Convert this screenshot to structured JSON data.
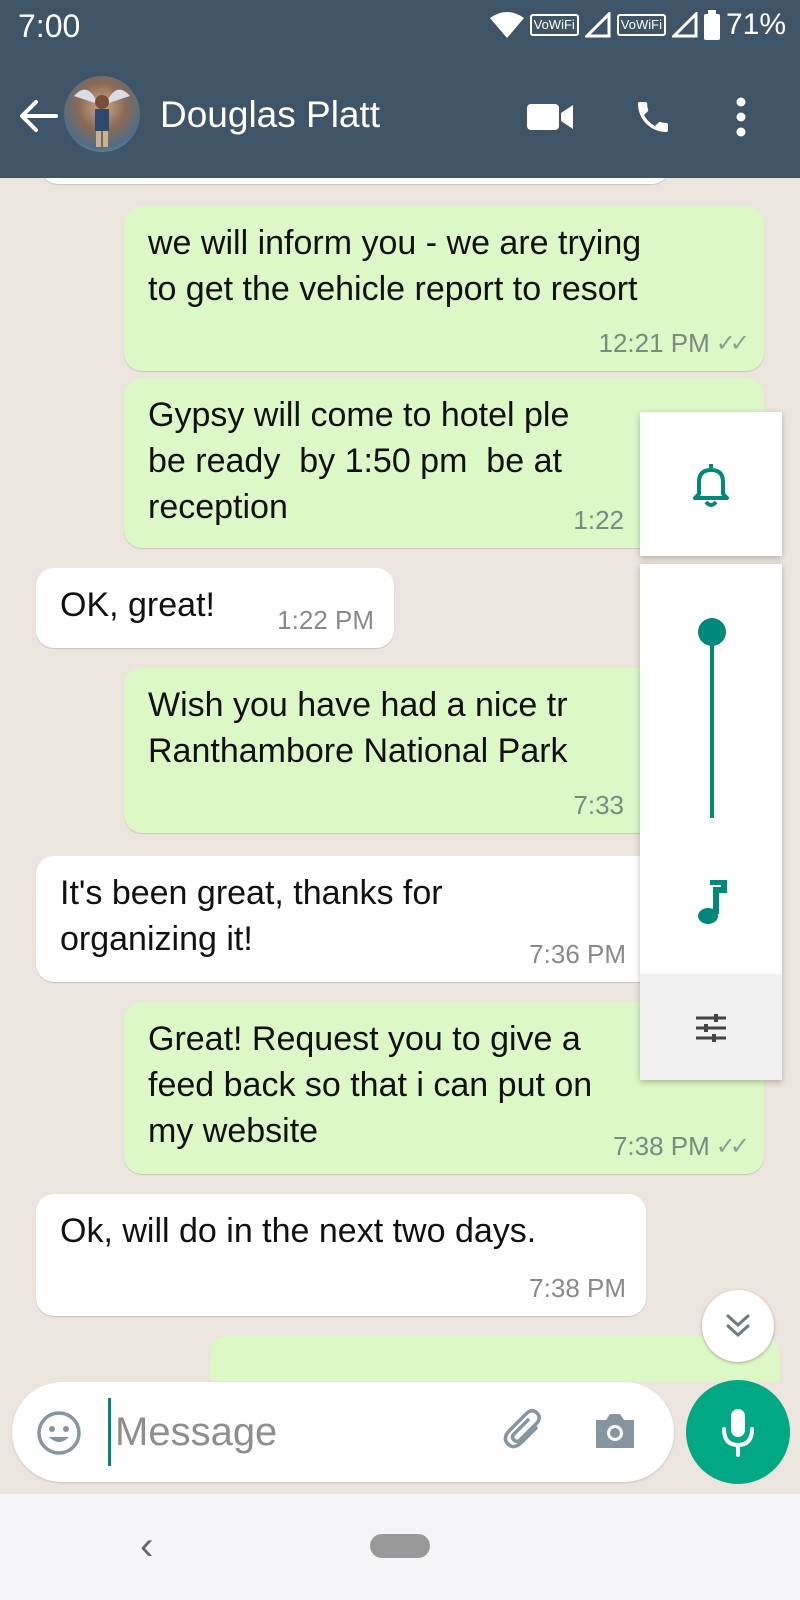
{
  "status_bar": {
    "time": "7:00",
    "vowifi_1": "VoWiFi",
    "vowifi_2": "VoWiFi",
    "battery": "71%"
  },
  "header": {
    "contact_name": "Douglas Platt",
    "icons": [
      "back-arrow-icon",
      "video-call-icon",
      "phone-call-icon",
      "more-options-icon"
    ]
  },
  "messages": [
    {
      "direction": "outgoing",
      "text": "we will inform you - we are trying\nto get the vehicle report to resort",
      "time": "12:21 PM",
      "read": true
    },
    {
      "direction": "outgoing",
      "text": "Gypsy will come to hotel ple\nbe ready  by 1:50 pm  be at\nreception",
      "time": "1:22",
      "read": false
    },
    {
      "direction": "incoming",
      "text": "OK, great!",
      "time": "1:22 PM"
    },
    {
      "direction": "outgoing",
      "text": "Wish you have had a nice tr\nRanthambore National Park",
      "time": "7:33",
      "read": false
    },
    {
      "direction": "incoming",
      "text": "It's been great, thanks for\norganizing it!",
      "time": "7:36 PM"
    },
    {
      "direction": "outgoing",
      "text": "Great! Request you to give a\nfeed back so that i can put on\nmy website",
      "time": "7:38 PM",
      "read": true
    },
    {
      "direction": "incoming",
      "text": "Ok, will do in the next two days.",
      "time": "7:38 PM"
    }
  ],
  "volume_panel": {
    "icons": [
      "bell-icon",
      "music-note-icon",
      "sliders-icon"
    ],
    "media_level": 1.0
  },
  "composer": {
    "placeholder": "Message"
  },
  "colors": {
    "header": "#3d5566",
    "outgoing_bubble": "#dcf8c6",
    "incoming_bubble": "#ffffff",
    "accent": "#00a884",
    "chat_background": "#ece5dd"
  }
}
